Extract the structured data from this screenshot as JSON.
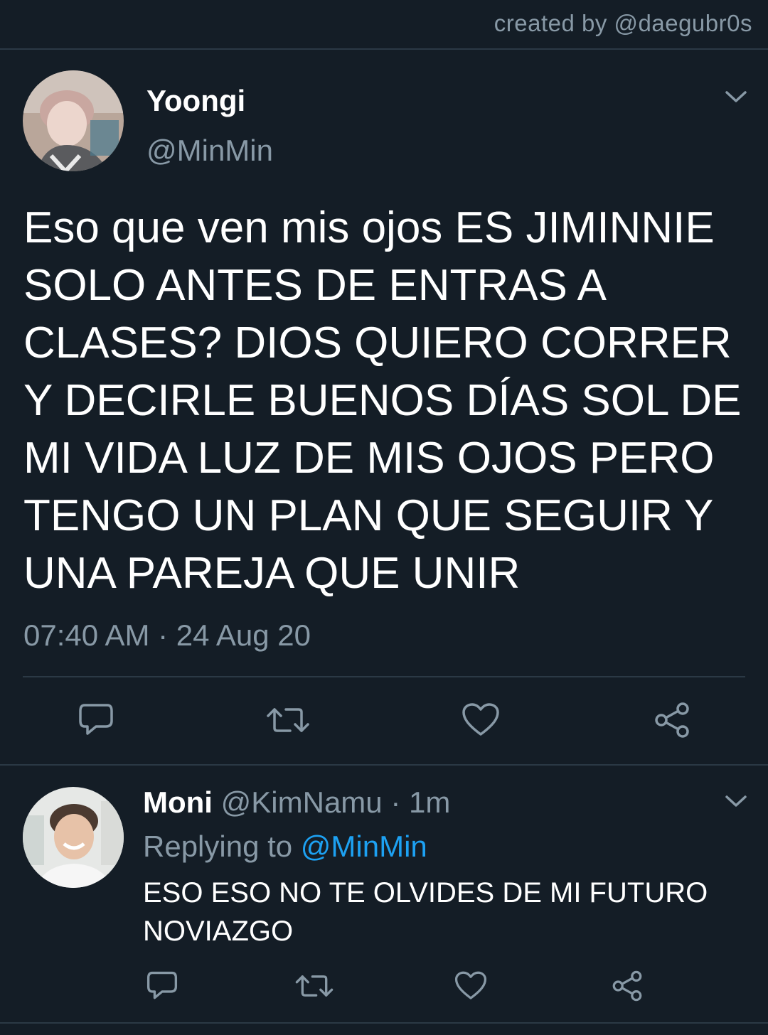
{
  "header": {
    "credit": "created by @daegubr0s"
  },
  "main_tweet": {
    "display_name": "Yoongi",
    "handle": "@MinMin",
    "text": "Eso que ven mis ojos ES JIMINNIE\nSOLO ANTES DE ENTRAS A\nCLASES? DIOS QUIERO CORRER\nY DECIRLE BUENOS DÍAS SOL DE\nMI VIDA LUZ DE MIS OJOS PERO\nTENGO UN PLAN QUE SEGUIR Y\nUNA PAREJA QUE UNIR",
    "timestamp": "07:40 AM · 24 Aug 20",
    "actions": [
      "reply-icon",
      "retweet-icon",
      "like-icon",
      "share-icon"
    ]
  },
  "reply_tweet": {
    "display_name": "Moni",
    "handle": "@KimNamu",
    "separator": "·",
    "time": "1m",
    "replying_label": "Replying to",
    "replying_to": "@MinMin",
    "text": "ESO ESO NO TE OLVIDES DE MI FUTURO NOVIAZGO",
    "actions": [
      "reply-icon",
      "retweet-icon",
      "like-icon",
      "share-icon"
    ]
  },
  "colors": {
    "background": "#141d26",
    "secondary_text": "#8899a6",
    "accent": "#1da1f2",
    "divider": "#2b3945"
  }
}
